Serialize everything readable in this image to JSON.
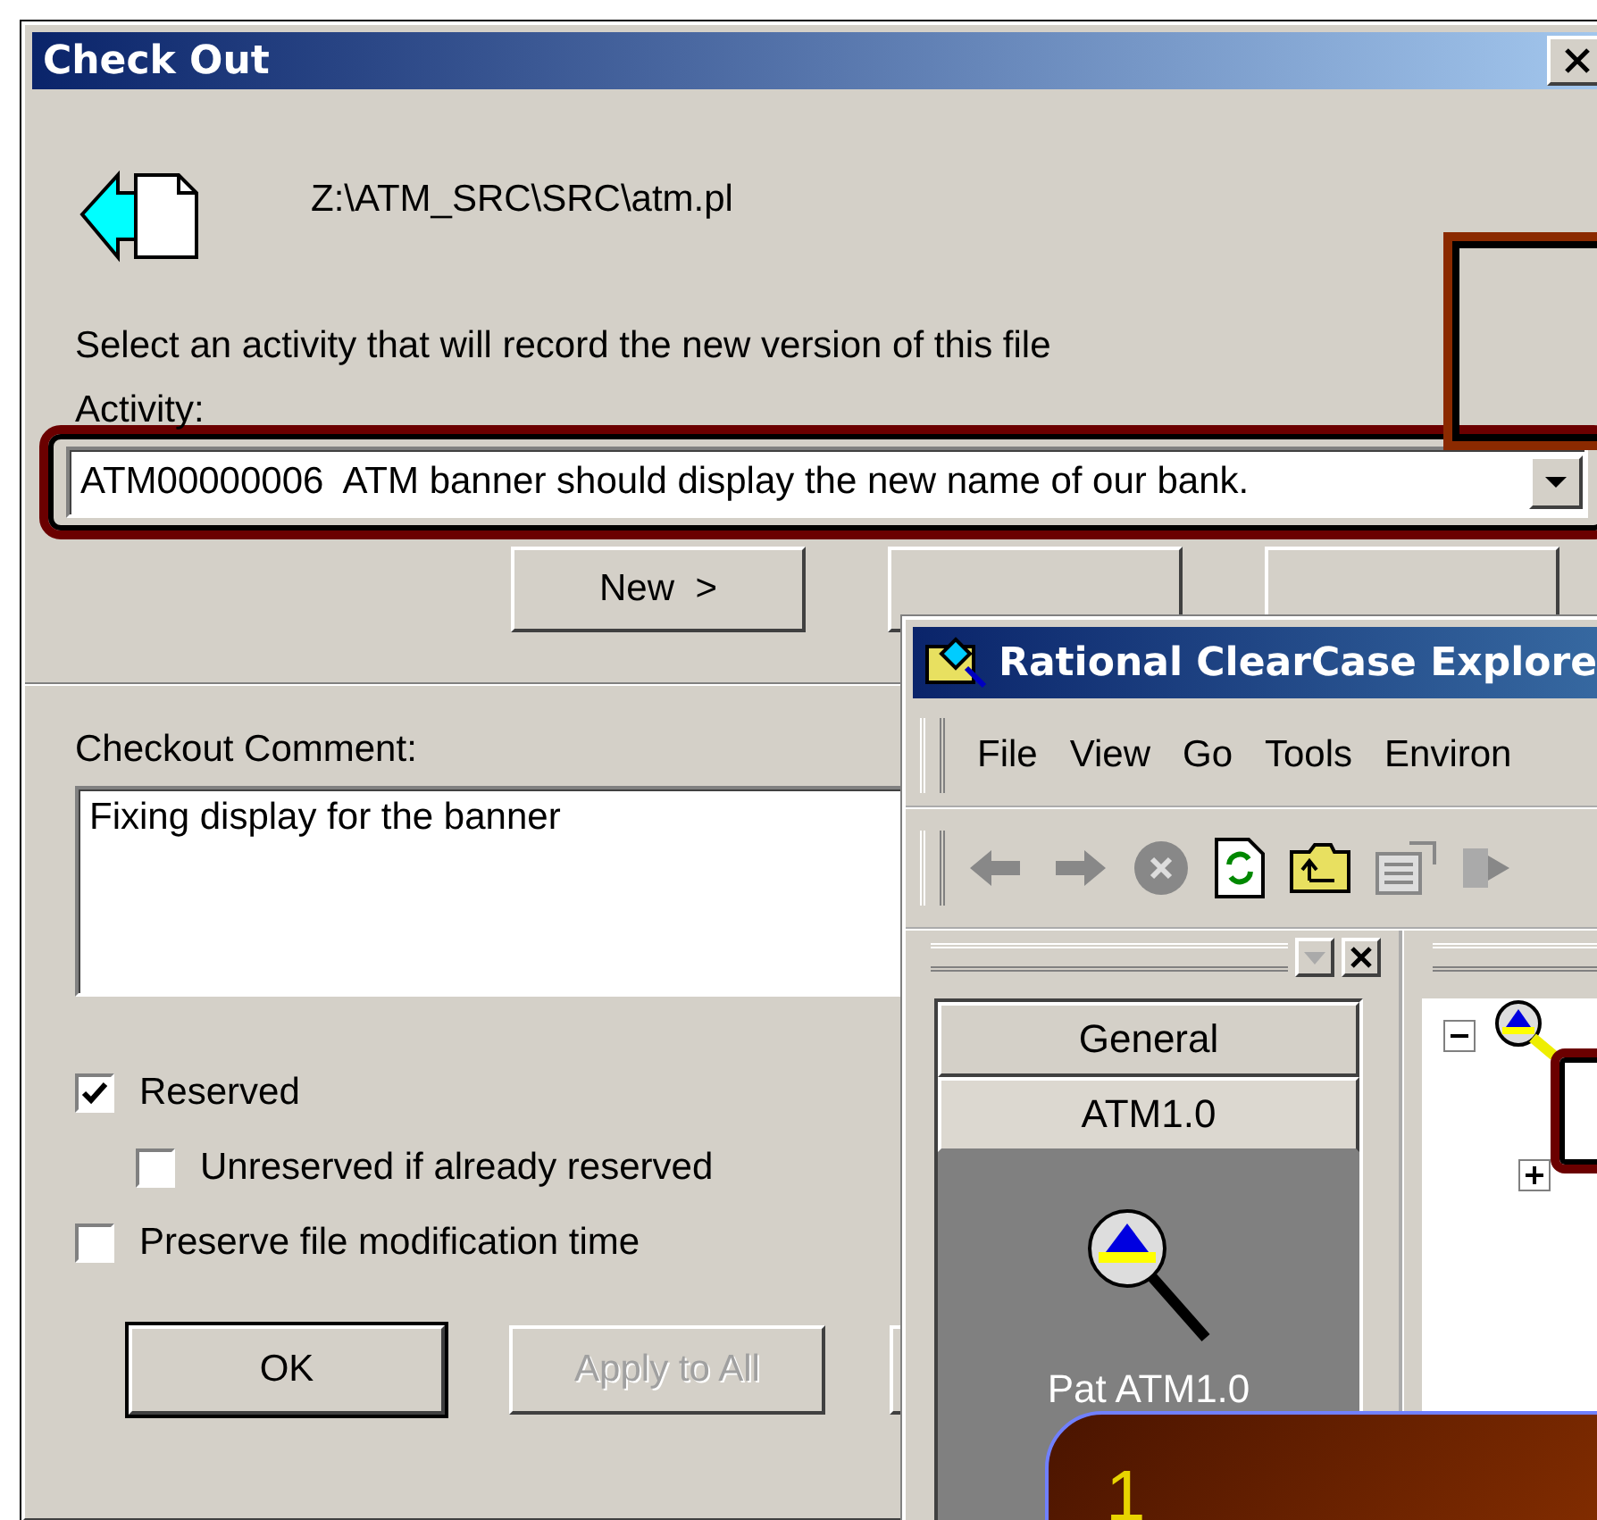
{
  "dialog": {
    "title": "Check Out",
    "file_path": "Z:\\ATM_SRC\\SRC\\atm.pl",
    "instruction": "Select an activity that will record the new version of this file",
    "activity_label": "Activity:",
    "activity_value": "ATM00000006  ATM banner should display the new name of our bank.",
    "new_button": "New  >",
    "comment_label": "Checkout Comment:",
    "comment": "Fixing display for the banner",
    "options": [
      {
        "label": "Reserved",
        "checked": true,
        "children": [
          {
            "label": "Unreserved if already reserved",
            "checked": false
          }
        ]
      },
      {
        "label": "Preserve file modification time",
        "checked": false
      }
    ],
    "buttons": [
      {
        "label": "OK",
        "default": true,
        "disabled": false
      },
      {
        "label": "Apply to All",
        "default": false,
        "disabled": true
      }
    ]
  },
  "explorer": {
    "title": "Rational ClearCase Explore",
    "menu": [
      "File",
      "View",
      "Go",
      "Tools",
      "Environ"
    ],
    "shortcut_groups": [
      {
        "label": "General",
        "selected": false
      },
      {
        "label": "ATM1.0",
        "selected": true
      }
    ],
    "shortcut_item": "Pat ATM1.0"
  },
  "callout": {
    "text": "1"
  }
}
